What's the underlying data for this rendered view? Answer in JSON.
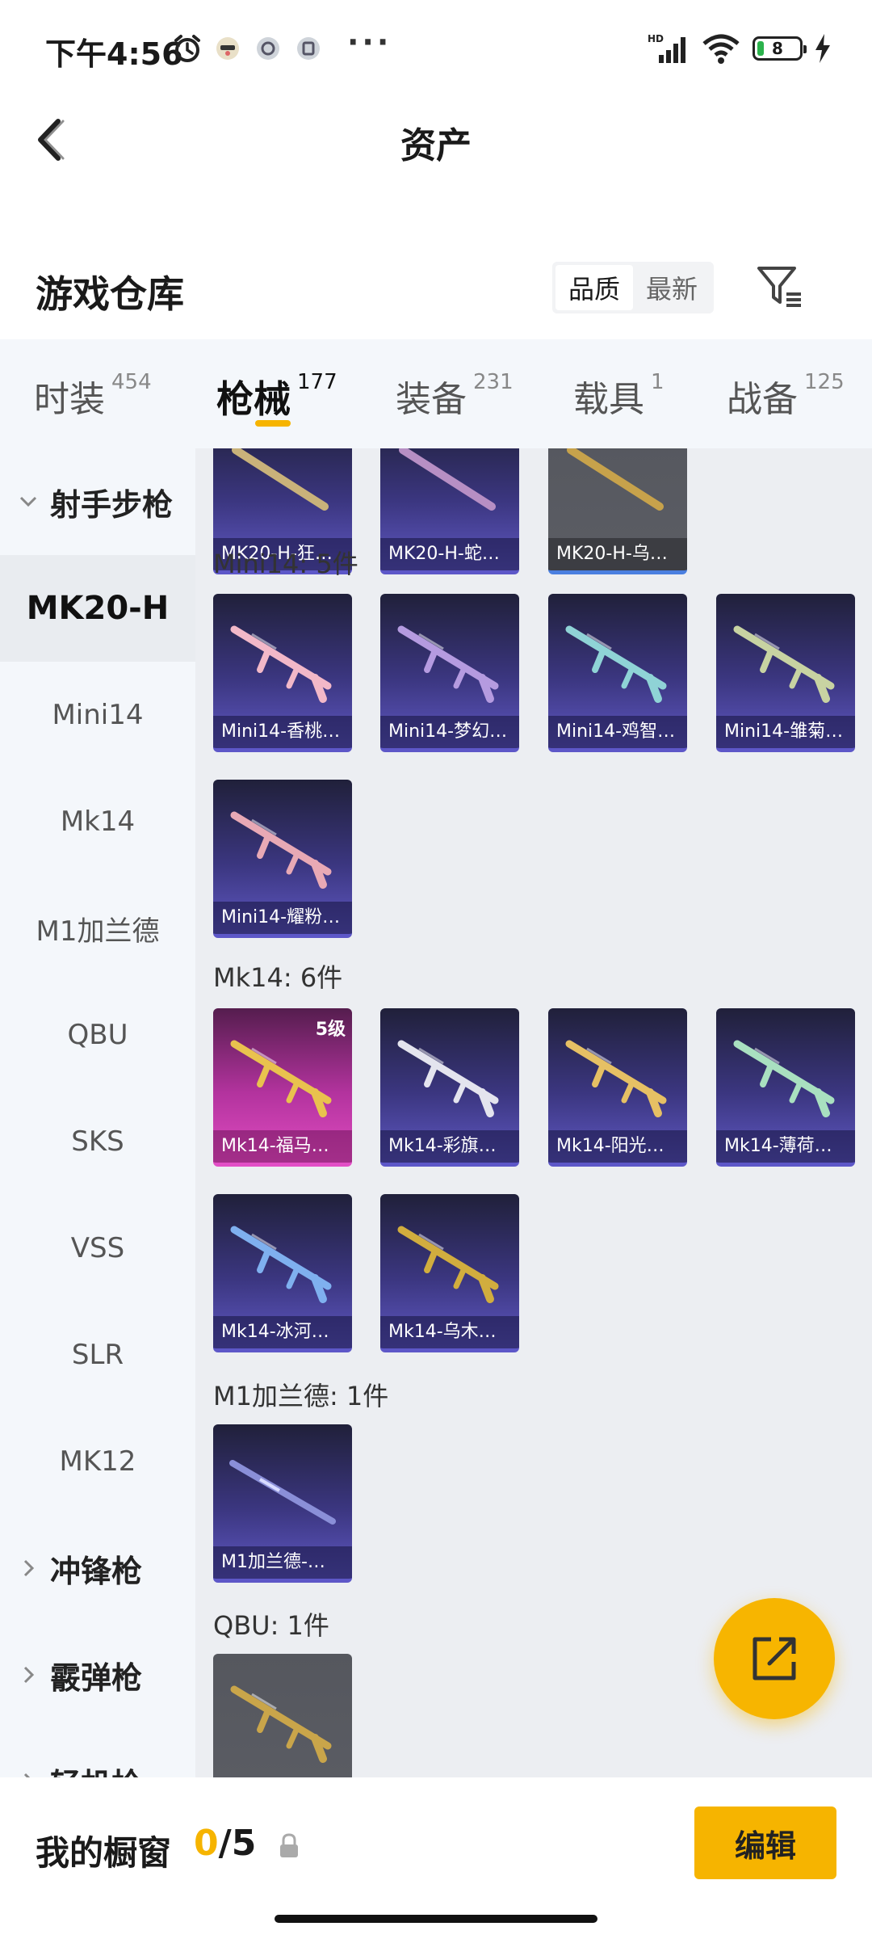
{
  "status_bar": {
    "time": "下午4:56",
    "more": "···",
    "network": "HD",
    "battery": "8"
  },
  "header": {
    "title": "资产"
  },
  "warehouse": {
    "title": "游戏仓库",
    "sort_options": [
      "品质",
      "最新"
    ],
    "active_sort": 0
  },
  "tabs": [
    {
      "label": "时装",
      "count": "454"
    },
    {
      "label": "枪械",
      "count": "177"
    },
    {
      "label": "装备",
      "count": "231"
    },
    {
      "label": "载具",
      "count": "1"
    },
    {
      "label": "战备",
      "count": "125"
    }
  ],
  "sidebar": {
    "group_rifles": "射手步枪",
    "items": [
      "MK20-H",
      "Mini14",
      "Mk14",
      "M1加兰德",
      "QBU",
      "SKS",
      "VSS",
      "SLR",
      "MK12"
    ],
    "group_smg": "冲锋枪",
    "group_shotgun": "霰弹枪",
    "group_lmg": "轻机枪"
  },
  "sections": {
    "mk20_cards": [
      "MK20-H-狂…",
      "MK20-H-蛇…",
      "MK20-H-乌…"
    ],
    "mini14": {
      "title": "Mini14: 5件",
      "cards": [
        "Mini14-香桃…",
        "Mini14-梦幻…",
        "Mini14-鸡智…",
        "Mini14-雏菊…",
        "Mini14-耀粉…"
      ]
    },
    "mk14": {
      "title": "Mk14: 6件",
      "level": "5级",
      "cards": [
        "Mk14-福马…",
        "Mk14-彩旗…",
        "Mk14-阳光…",
        "Mk14-薄荷…",
        "Mk14-冰河…",
        "Mk14-乌木…"
      ]
    },
    "m1": {
      "title": "M1加兰德: 1件",
      "cards": [
        "M1加兰德-…"
      ]
    },
    "qbu": {
      "title": "QBU: 1件"
    }
  },
  "bottom": {
    "label": "我的橱窗",
    "current": "0",
    "sep": "/",
    "max": "5",
    "edit": "编辑"
  },
  "colors": {
    "accent": "#f6b400",
    "card_purple": "#3b3680",
    "card_pink": "#b3339e"
  }
}
